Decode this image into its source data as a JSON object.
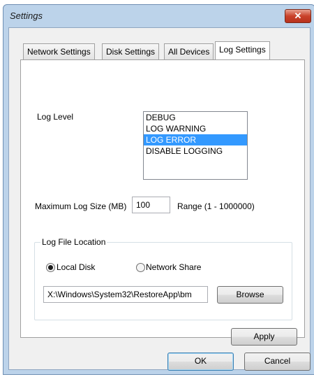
{
  "window": {
    "title": "Settings",
    "close_glyph": "✕"
  },
  "tabs": [
    {
      "label": "Network Settings"
    },
    {
      "label": "Disk Settings"
    },
    {
      "label": "All Devices"
    },
    {
      "label": "Log Settings",
      "active": true
    }
  ],
  "log_level": {
    "label": "Log Level",
    "options": [
      "DEBUG",
      "LOG WARNING",
      "LOG ERROR",
      "DISABLE LOGGING"
    ],
    "selected": "LOG ERROR"
  },
  "max_log_size": {
    "label": "Maximum Log Size (MB)",
    "value": "100",
    "range_text": "Range (1 - 1000000)"
  },
  "log_file_location": {
    "group_title": "Log File Location",
    "local_disk_label": "Local Disk",
    "network_share_label": "Network Share",
    "selected": "Local Disk",
    "path_value": "X:\\Windows\\System32\\RestoreApp\\bm",
    "browse_label": "Browse"
  },
  "buttons": {
    "apply": "Apply",
    "ok": "OK",
    "cancel": "Cancel"
  },
  "colors": {
    "selection": "#3399ff",
    "title_bar": "#bcd3ea",
    "close_button": "#c9412a"
  }
}
